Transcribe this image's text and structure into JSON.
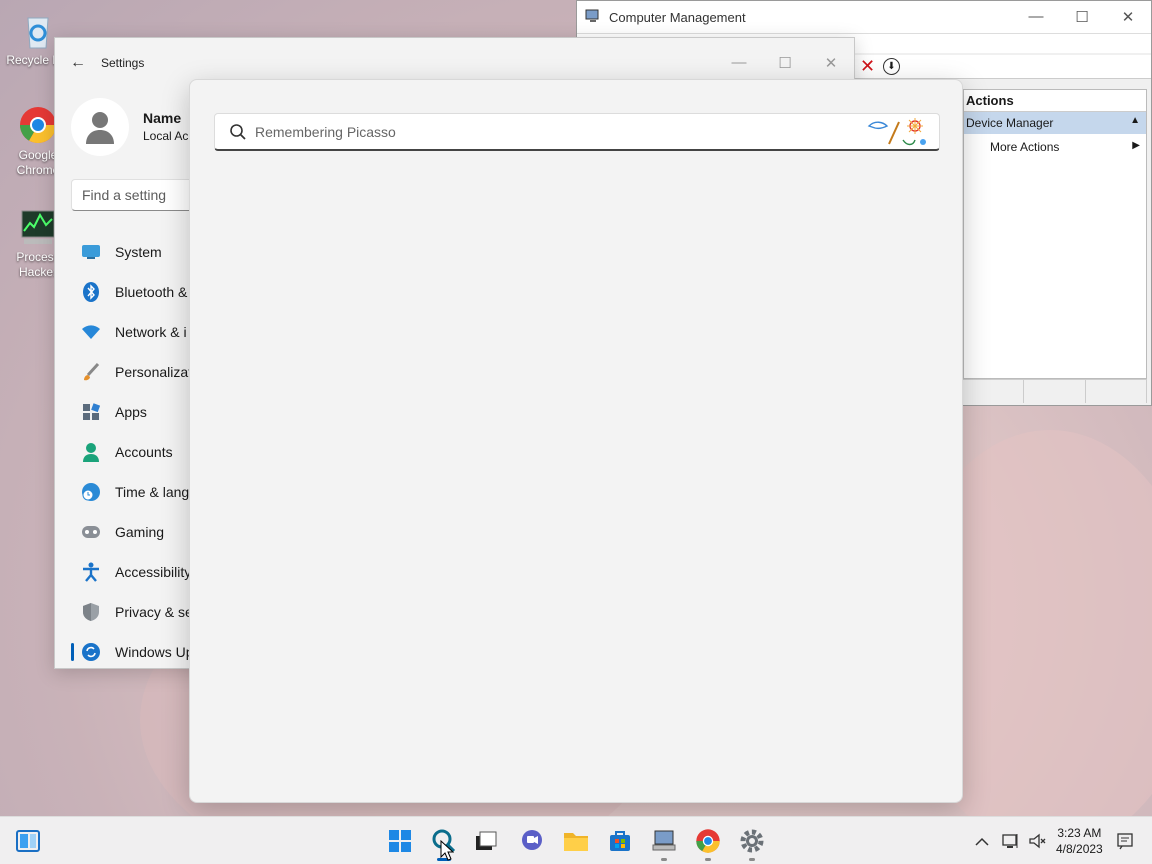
{
  "desktop": {
    "icons": [
      {
        "label": "Recycle Bin",
        "icon": "recycle-bin-icon"
      },
      {
        "label": "Google Chrome",
        "icon": "chrome-icon"
      },
      {
        "label": "Process Hacker",
        "icon": "process-hacker-icon"
      }
    ]
  },
  "computer_management": {
    "title": "Computer Management",
    "actions_header": "Actions",
    "selected_action": "Device Manager",
    "more_actions": "More Actions"
  },
  "settings": {
    "title": "Settings",
    "profile": {
      "name": "Name",
      "type": "Local Ac"
    },
    "find_placeholder": "Find a setting",
    "nav": [
      {
        "label": "System",
        "icon": "monitor-icon"
      },
      {
        "label": "Bluetooth &",
        "icon": "bluetooth-icon"
      },
      {
        "label": "Network & i",
        "icon": "wifi-icon"
      },
      {
        "label": "Personalizat",
        "icon": "brush-icon"
      },
      {
        "label": "Apps",
        "icon": "apps-icon"
      },
      {
        "label": "Accounts",
        "icon": "person-icon"
      },
      {
        "label": "Time & lang",
        "icon": "globe-clock-icon"
      },
      {
        "label": "Gaming",
        "icon": "gamepad-icon"
      },
      {
        "label": "Accessibility",
        "icon": "accessibility-icon"
      },
      {
        "label": "Privacy & se",
        "icon": "shield-icon"
      },
      {
        "label": "Windows Up",
        "icon": "update-icon"
      }
    ]
  },
  "search": {
    "placeholder": "Remembering Picasso",
    "value": ""
  },
  "taskbar": {
    "apps": [
      "widgets-icon",
      "start-icon",
      "search-icon",
      "task-view-icon",
      "teams-chat-icon",
      "file-explorer-icon",
      "store-icon",
      "computer-management-icon",
      "chrome-icon",
      "settings-gear-icon"
    ],
    "time": "3:23 AM",
    "date": "4/8/2023"
  },
  "colors": {
    "accent": "#005fb8",
    "desktop": "#d8c0c2"
  }
}
